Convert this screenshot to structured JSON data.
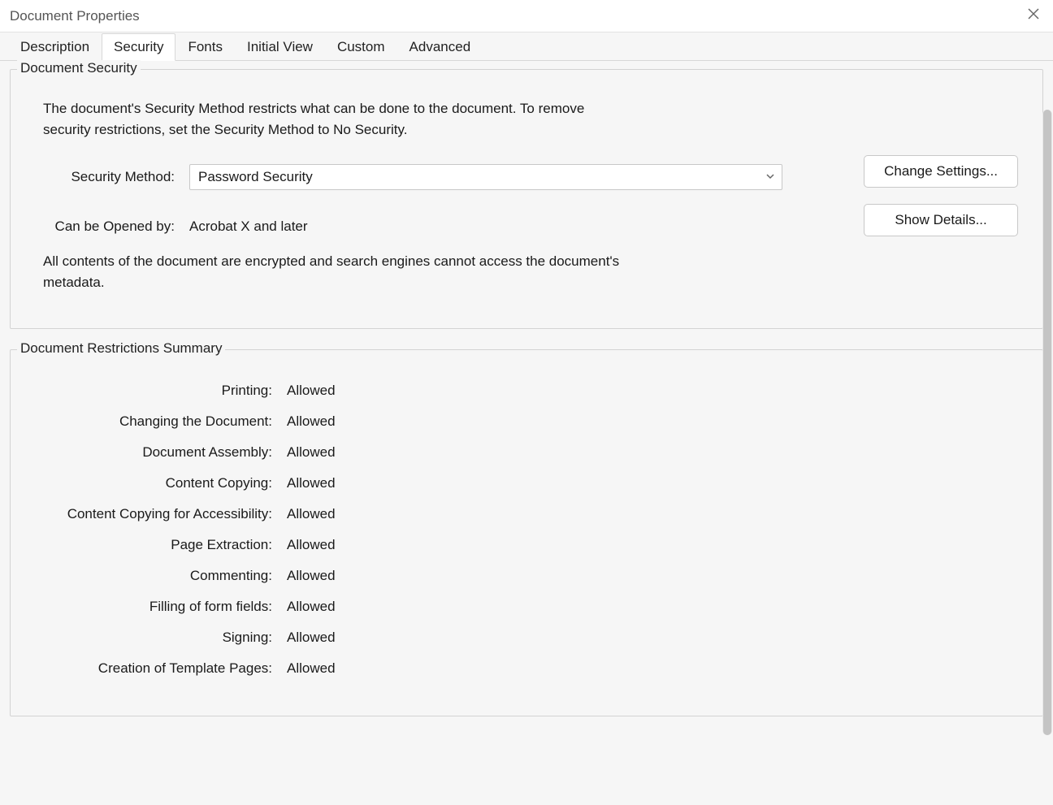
{
  "window": {
    "title": "Document Properties"
  },
  "tabs": [
    {
      "label": "Description"
    },
    {
      "label": "Security"
    },
    {
      "label": "Fonts"
    },
    {
      "label": "Initial View"
    },
    {
      "label": "Custom"
    },
    {
      "label": "Advanced"
    }
  ],
  "activeTab": "Security",
  "security": {
    "legend": "Document Security",
    "intro": "The document's Security Method restricts what can be done to the document. To remove security restrictions, set the Security Method to No Security.",
    "method_label": "Security Method:",
    "method_value": "Password Security",
    "change_settings_label": "Change Settings...",
    "opened_by_label": "Can be Opened by:",
    "opened_by_value": "Acrobat X and later",
    "show_details_label": "Show Details...",
    "encrypt_note": "All contents of the document are encrypted and search engines cannot access the document's metadata."
  },
  "restrictions": {
    "legend": "Document Restrictions Summary",
    "items": [
      {
        "label": "Printing:",
        "value": "Allowed"
      },
      {
        "label": "Changing the Document:",
        "value": "Allowed"
      },
      {
        "label": "Document Assembly:",
        "value": "Allowed"
      },
      {
        "label": "Content Copying:",
        "value": "Allowed"
      },
      {
        "label": "Content Copying for Accessibility:",
        "value": "Allowed"
      },
      {
        "label": "Page Extraction:",
        "value": "Allowed"
      },
      {
        "label": "Commenting:",
        "value": "Allowed"
      },
      {
        "label": "Filling of form fields:",
        "value": "Allowed"
      },
      {
        "label": "Signing:",
        "value": "Allowed"
      },
      {
        "label": "Creation of Template Pages:",
        "value": "Allowed"
      }
    ]
  }
}
